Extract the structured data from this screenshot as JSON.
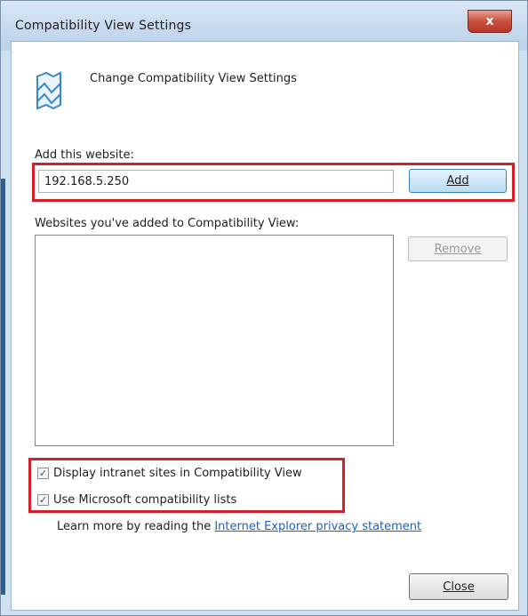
{
  "window": {
    "title": "Compatibility View Settings",
    "close_glyph": "x"
  },
  "header": {
    "icon": "compatibility-view-icon",
    "text": "Change Compatibility View Settings"
  },
  "add_section": {
    "label_prefix": "Add this website:",
    "input_value": "192.168.5.250",
    "add_button_label": "Add"
  },
  "list_section": {
    "label": "Websites you've added to Compatibility View:",
    "items": [],
    "remove_button_label": "Remove"
  },
  "options": {
    "display_intranet": {
      "label": "Display intranet sites in Compatibility View",
      "checked": true
    },
    "use_ms_lists": {
      "label": "Use Microsoft compatibility lists",
      "checked": true
    }
  },
  "learn_more": {
    "prefix": "Learn more by reading the",
    "link_text": "Internet Explorer privacy statement"
  },
  "footer": {
    "close_button_label": "Close"
  },
  "colors": {
    "highlight": "#d2202a",
    "link": "#1b62c9",
    "title_bar": "#c6d9ee"
  }
}
